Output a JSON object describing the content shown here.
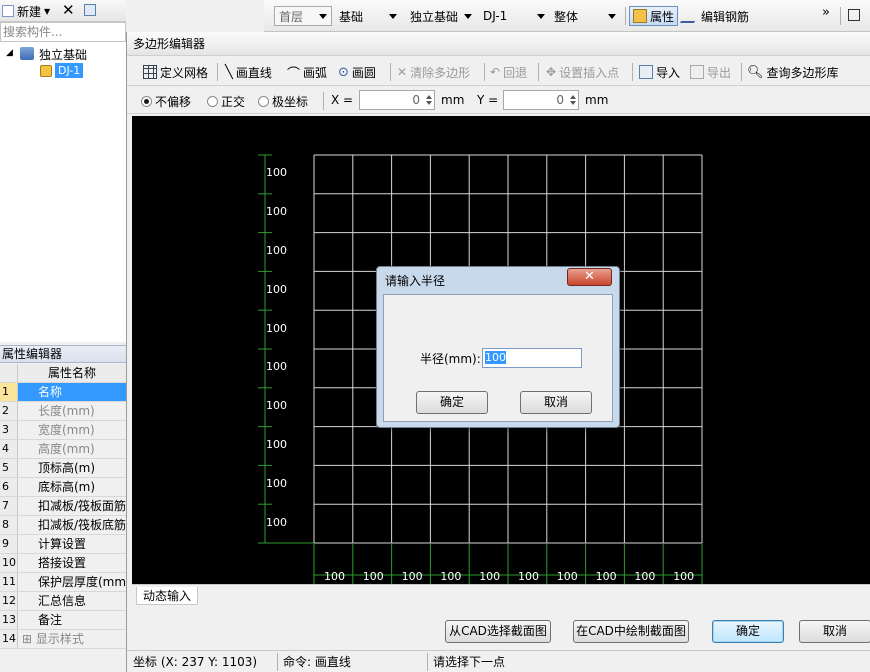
{
  "left_panel": {
    "new_label": "新建",
    "search_placeholder": "搜索构件...",
    "tree": {
      "root": "独立基础",
      "child": "DJ-1"
    },
    "prop_editor_title": "属性编辑器",
    "prop_header": "属性名称",
    "props": [
      {
        "num": "1",
        "name": "名称",
        "state": "selected"
      },
      {
        "num": "2",
        "name": "长度(mm)",
        "state": "gray"
      },
      {
        "num": "3",
        "name": "宽度(mm)",
        "state": "gray"
      },
      {
        "num": "4",
        "name": "高度(mm)",
        "state": "gray"
      },
      {
        "num": "5",
        "name": "顶标高(m)",
        "state": "normal"
      },
      {
        "num": "6",
        "name": "底标高(m)",
        "state": "normal"
      },
      {
        "num": "7",
        "name": "扣减板/筏板面筋",
        "state": "normal"
      },
      {
        "num": "8",
        "name": "扣减板/筏板底筋",
        "state": "normal"
      },
      {
        "num": "9",
        "name": "计算设置",
        "state": "normal"
      },
      {
        "num": "10",
        "name": "搭接设置",
        "state": "normal"
      },
      {
        "num": "11",
        "name": "保护层厚度(mm)",
        "state": "normal"
      },
      {
        "num": "12",
        "name": "汇总信息",
        "state": "normal"
      },
      {
        "num": "13",
        "name": "备注",
        "state": "normal"
      },
      {
        "num": "14",
        "name": "显示样式",
        "state": "gray"
      }
    ]
  },
  "main_toolbar": {
    "floor": "首层",
    "category": "基础",
    "type": "独立基础",
    "component": "DJ-1",
    "scope": "整体",
    "properties_label": "属性",
    "edit_rebar_label": "编辑钢筋",
    "overflow": "»"
  },
  "editor": {
    "title": "多边形编辑器",
    "tools": {
      "define_grid": "定义网格",
      "draw_line": "画直线",
      "draw_arc": "画弧",
      "draw_circle": "画圆",
      "clear_polygon": "清除多边形",
      "undo": "回退",
      "set_insert_point": "设置插入点",
      "import": "导入",
      "export": "导出",
      "query_library": "查询多边形库"
    },
    "offset_options": {
      "none": "不偏移",
      "ortho": "正交",
      "polar": "极坐标"
    },
    "x_label": "X =",
    "x_value": "0",
    "y_label": "Y =",
    "y_value": "0",
    "unit": "mm",
    "grid": {
      "row_labels": [
        "100",
        "100",
        "100",
        "100",
        "100",
        "100",
        "100",
        "100",
        "100",
        "100"
      ],
      "col_labels": [
        "100",
        "100",
        "100",
        "100",
        "100",
        "100",
        "100",
        "100",
        "100",
        "100"
      ]
    },
    "dynamic_input_tab": "动态输入",
    "btn_select_from_cad": "从CAD选择截面图",
    "btn_draw_in_cad": "在CAD中绘制截面图",
    "btn_ok": "确定",
    "btn_cancel": "取消",
    "status": {
      "coords": "坐标 (X: 237 Y: 1103)",
      "command": "命令: 画直线",
      "prompt": "请选择下一点"
    }
  },
  "dialog": {
    "title": "请输入半径",
    "close": "✕",
    "field_label": "半径(mm):",
    "field_value": "100",
    "ok": "确定",
    "cancel": "取消"
  }
}
